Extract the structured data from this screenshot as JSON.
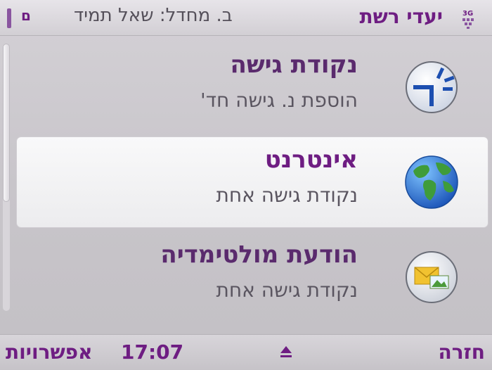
{
  "header": {
    "title": "יעדי רשת",
    "subtitle": "ב. מחדל: שאל תמיד",
    "battery_label": "ם"
  },
  "list": {
    "items": [
      {
        "title": "נקודת גישה",
        "subtitle": "הוספת נ. גישה חד'",
        "icon": "access-point-icon"
      },
      {
        "title": "אינטרנט",
        "subtitle": "נקודת גישה אחת",
        "icon": "globe-icon",
        "selected": true
      },
      {
        "title": "הודעת מולטימדיה",
        "subtitle": "נקודת גישה אחת",
        "icon": "mms-envelope-icon"
      }
    ]
  },
  "softkeys": {
    "left": "אפשרויות",
    "right": "חזרה",
    "clock": "17:07"
  },
  "colors": {
    "accent": "#6e1d82",
    "background": "#c9c6cb"
  }
}
